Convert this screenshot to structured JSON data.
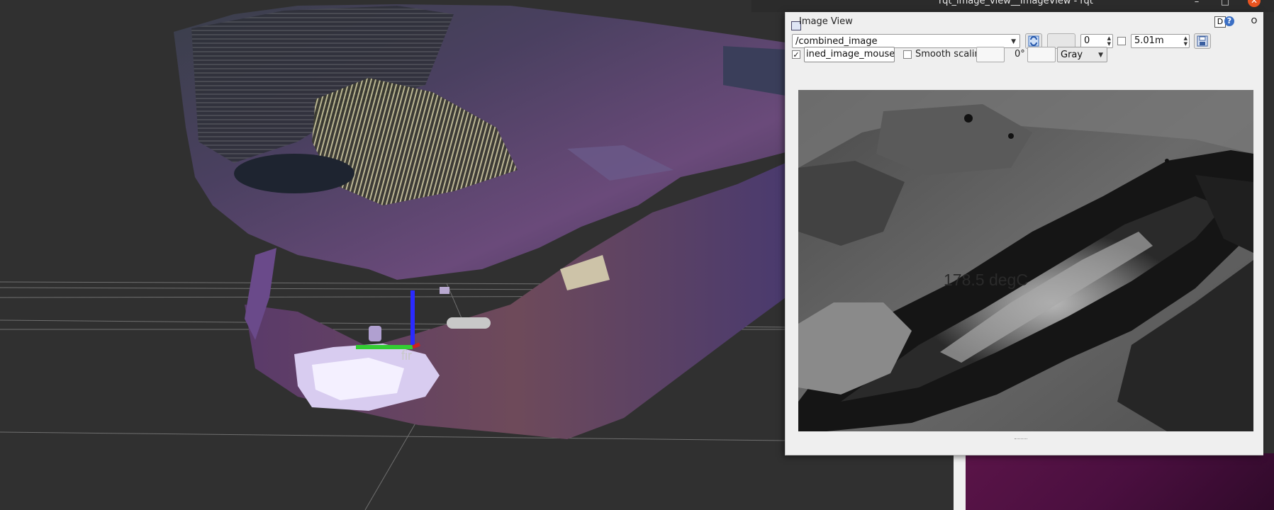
{
  "window": {
    "title": "rqt_image_view__ImageView - rqt",
    "close_glyph": "✕",
    "minimize_glyph": "–",
    "maximize_glyph": "□"
  },
  "dock": {
    "title": "Image View",
    "d_label": "D",
    "help_label": "?",
    "close_label": "O"
  },
  "toolbar": {
    "topic": "/combined_image",
    "refresh_icon": "refresh-icon",
    "spin_value": "0",
    "max_range": "5.01m",
    "save_icon": "save-icon",
    "dynamic_range_checked": false
  },
  "row2": {
    "mouse_topic_checked": true,
    "mouse_topic_value": "ined_image_mouse_left",
    "smooth_label": "Smooth scaling",
    "smooth_checked": false,
    "rotation": "0°",
    "colormap": "Gray"
  },
  "image": {
    "temperature_text": "178.5 degC"
  },
  "rviz": {
    "frame_label": "fir",
    "axis_colors": {
      "z": "#2a2aff",
      "y": "#33cc33",
      "x": "#cc2222"
    }
  },
  "colors": {
    "accent_close": "#e95420",
    "rviz_bg": "#303030",
    "wallpaper": "#4a0f3f"
  }
}
